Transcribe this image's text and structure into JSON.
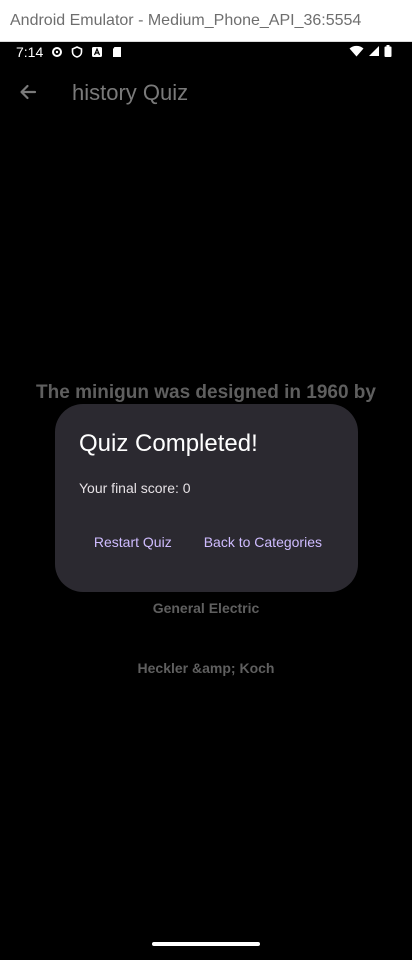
{
  "emulator": {
    "title": "Android Emulator - Medium_Phone_API_36:5554"
  },
  "status_bar": {
    "time": "7:14",
    "left_icons": [
      "settings-icon",
      "shield-icon",
      "font-icon",
      "sdcard-icon"
    ],
    "right_icons": [
      "wifi-icon",
      "signal-icon",
      "battery-icon"
    ]
  },
  "app_bar": {
    "title": "history Quiz",
    "back_icon": "arrow-back-icon"
  },
  "question": {
    "text": "The minigun was designed in 1960 by"
  },
  "answers": [
    {
      "label": "General Electric"
    },
    {
      "label": "Heckler &amp; Koch"
    }
  ],
  "dialog": {
    "title": "Quiz Completed!",
    "body": "Your final score: 0",
    "actions": {
      "restart": "Restart Quiz",
      "back": "Back to Categories"
    }
  },
  "colors": {
    "background": "#000000",
    "dialog_surface": "#2b2930",
    "dialog_action": "#cfbcff",
    "dimmed_text": "#5f5f5f"
  }
}
